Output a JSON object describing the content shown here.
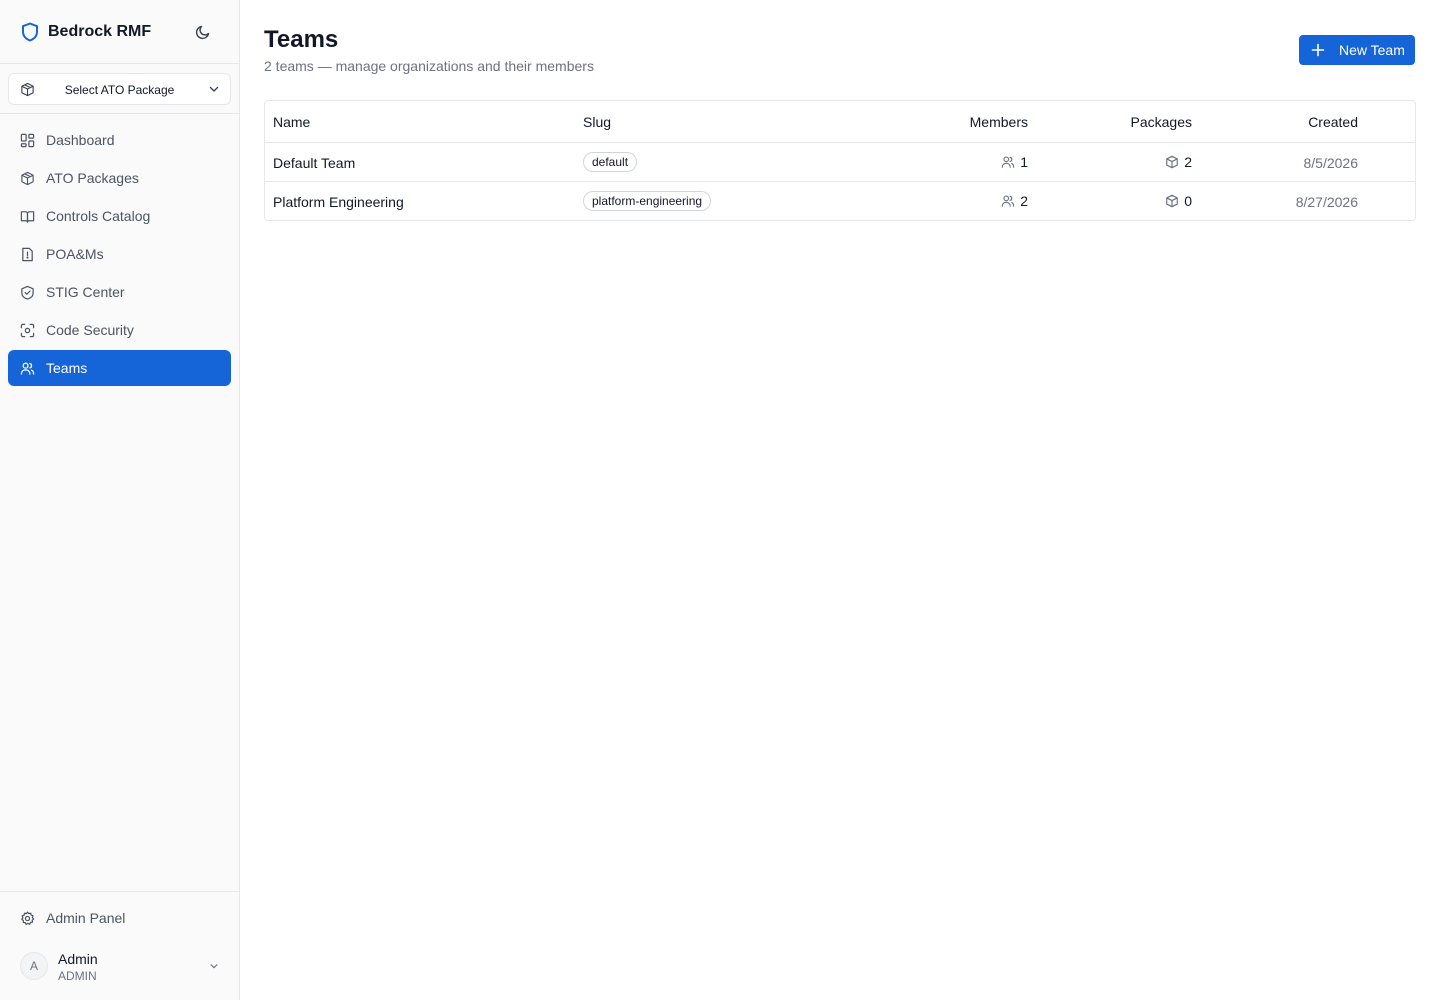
{
  "app": {
    "title": "Bedrock RMF"
  },
  "package_select": {
    "label": "Select ATO Package"
  },
  "sidebar": {
    "items": [
      {
        "label": "Dashboard",
        "icon": "dashboard-icon"
      },
      {
        "label": "ATO Packages",
        "icon": "package-icon"
      },
      {
        "label": "Controls Catalog",
        "icon": "book-icon"
      },
      {
        "label": "POA&Ms",
        "icon": "file-alert-icon"
      },
      {
        "label": "STIG Center",
        "icon": "shield-check-icon"
      },
      {
        "label": "Code Security",
        "icon": "scan-icon"
      },
      {
        "label": "Teams",
        "icon": "users-icon",
        "active": true
      }
    ],
    "admin_panel": "Admin Panel",
    "user": {
      "initial": "A",
      "name": "Admin",
      "role": "ADMIN"
    }
  },
  "page": {
    "title": "Teams",
    "subtitle": "2 teams — manage organizations and their members",
    "new_button": "New Team"
  },
  "table": {
    "headers": {
      "name": "Name",
      "slug": "Slug",
      "members": "Members",
      "packages": "Packages",
      "created": "Created"
    },
    "rows": [
      {
        "name": "Default Team",
        "slug": "default",
        "members": "1",
        "packages": "2",
        "created": "8/5/2026"
      },
      {
        "name": "Platform Engineering",
        "slug": "platform-engineering",
        "members": "2",
        "packages": "0",
        "created": "8/27/2026"
      }
    ]
  },
  "colors": {
    "accent": "#1565d8",
    "sidebar_bg": "#fafafa",
    "border": "#e5e7eb",
    "muted_text": "#6b7280"
  }
}
